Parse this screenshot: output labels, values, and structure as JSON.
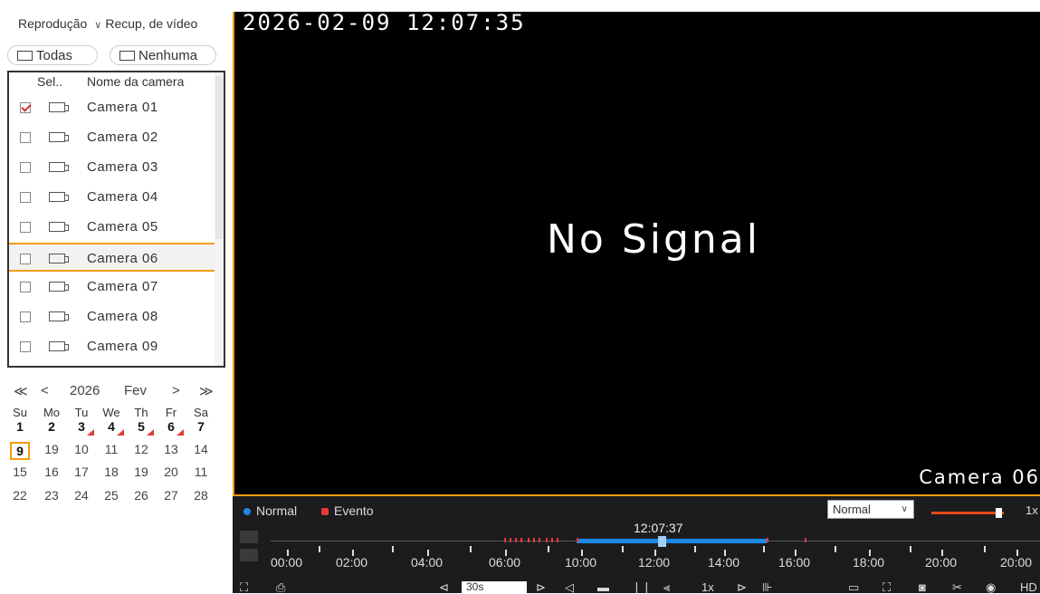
{
  "top_selector": {
    "mode": "Reprodução",
    "mode_chevron": "∨",
    "type": "Recup, de vídeo"
  },
  "select_all": "Todas",
  "select_none": "Nenhuma",
  "camera_list": {
    "header_sel": "Sel..",
    "header_name": "Nome da camera",
    "cameras": [
      {
        "name": "Camera 01",
        "checked": true
      },
      {
        "name": "Camera 02",
        "checked": false
      },
      {
        "name": "Camera 03",
        "checked": false
      },
      {
        "name": "Camera 04",
        "checked": false
      },
      {
        "name": "Camera 05",
        "checked": false
      },
      {
        "name": "Camera 06",
        "checked": false,
        "selected": true
      },
      {
        "name": "Camera 07",
        "checked": false
      },
      {
        "name": "Camera 08",
        "checked": false
      },
      {
        "name": "Camera 09",
        "checked": false
      }
    ]
  },
  "calendar": {
    "prev_year": "≪",
    "prev_month": "<",
    "year": "2026",
    "month": "Fev",
    "next_month": ">",
    "next_year": "≫",
    "weekdays": [
      "Su",
      "Mo",
      "Tu",
      "We",
      "Th",
      "Fr",
      "Sa"
    ],
    "weeks": [
      [
        "1",
        "2",
        "3",
        "4",
        "5",
        "6",
        "7"
      ],
      [
        "9",
        "19",
        "10",
        "11",
        "12",
        "13",
        "14"
      ],
      [
        "15",
        "16",
        "17",
        "18",
        "19",
        "20",
        "11"
      ],
      [
        "22",
        "23",
        "24",
        "25",
        "26",
        "27",
        "28"
      ]
    ],
    "today": "9"
  },
  "video": {
    "timestamp": "2026-02-09 12:07:35",
    "status": "No Signal",
    "camera_label": "Camera 06"
  },
  "timeline": {
    "legend_normal": "Normal",
    "legend_event": "Evento",
    "speed": "Normal",
    "volume_label": "1x",
    "current_time": "12:07:37",
    "labels": [
      "00:00",
      "02:00",
      "04:00",
      "06:00",
      "10:00",
      "12:00",
      "14:00",
      "16:00",
      "18:00",
      "20:00",
      "20:00"
    ]
  },
  "controls": {
    "interval": "30s",
    "speed_label": "1x",
    "quality": "HD"
  },
  "colors": {
    "accent": "#f39c12",
    "normal": "#1e88e5",
    "event": "#e53935"
  }
}
